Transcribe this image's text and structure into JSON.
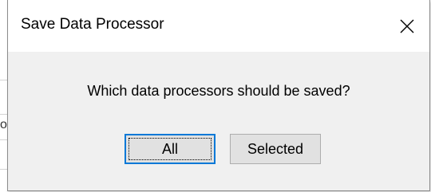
{
  "dialog": {
    "title": "Save Data Processor",
    "close_icon": "close-icon",
    "message": "Which data processors should be saved?",
    "buttons": {
      "all_label": "All",
      "selected_label": "Selected"
    }
  },
  "background": {
    "partial_glyph": "o"
  },
  "colors": {
    "dialog_bg": "#f0f0f0",
    "titlebar_bg": "#ffffff",
    "focus_accent": "#0078d7",
    "button_bg": "#e1e1e1"
  }
}
